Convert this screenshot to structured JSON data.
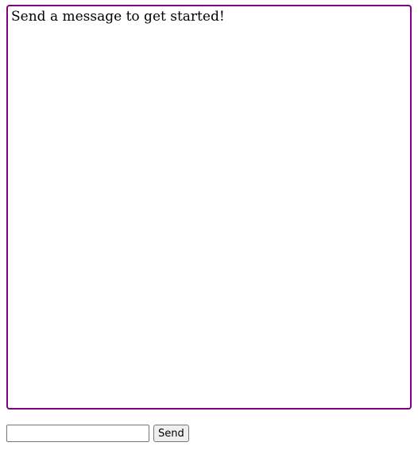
{
  "chat": {
    "placeholder_message": "Send a message to get started!"
  },
  "composer": {
    "input_value": "",
    "send_label": "Send"
  },
  "colors": {
    "chat_border": "#800080"
  }
}
